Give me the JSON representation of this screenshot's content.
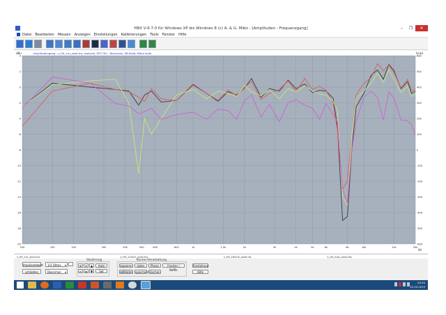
{
  "window": {
    "title": "HBX V-6.7.0 für Windows XP bis Windows 8   (c)  A. & G. Mätz - [Amplituden - Frequenzgang]",
    "controls": [
      "–",
      "❐",
      "✕"
    ]
  },
  "menu": {
    "items": [
      "Datei",
      "Bearbeiten",
      "Messen",
      "Anzeigen",
      "Einstellungen",
      "Kalibrierungen",
      "Tools",
      "Fenster",
      "Hilfe"
    ]
  },
  "toolbar": {
    "icons": [
      "folder-icon",
      "save-icon",
      "print-icon",
      "measure-icon",
      "sweep-icon",
      "impulse-icon",
      "waterfall-icon",
      "spectrum-icon",
      "phase-icon",
      "distortion-icon",
      "burst-icon",
      "filter-icon",
      "eq-icon",
      "tools-icon",
      "exit-icon"
    ],
    "colors": [
      "#2f6fd1",
      "#2a7fd0",
      "#7f8c9b",
      "#3a78c8",
      "#4a88d4",
      "#3c7cc2",
      "#3b70c0",
      "#b03a2e",
      "#1f2a44",
      "#4a64c8",
      "#c84040",
      "#305090",
      "#4b8ad6",
      "#2c8a3a",
      "#2f8a3a"
    ]
  },
  "chart_data": {
    "type": "line",
    "title": "Amplitudengang - s_HX_1m_axial.frq, analyzie, SPT-700 - Blackman, SB Kalib, Mikro kalib",
    "ylabel_left": "dBu",
    "ylabel_right": "Grad",
    "xlabel": "Hz",
    "x_scale": "log",
    "xlim": [
      100,
      20000
    ],
    "ylim": [
      -20,
      4
    ],
    "y2lim": [
      -600,
      600
    ],
    "left_ticks": [
      "4",
      "2",
      "0",
      "-2",
      "-4",
      "-6",
      "-8",
      "-10",
      "-12",
      "-14",
      "-16",
      "-18",
      "-20"
    ],
    "right_ticks": [
      "600",
      "500",
      "400",
      "300",
      "200",
      "100",
      "0",
      "-100",
      "-200",
      "-300",
      "-400",
      "-500",
      "-600"
    ],
    "x_ticks": [
      {
        "v": 100,
        "label": "100"
      },
      {
        "v": 150,
        "label": "150"
      },
      {
        "v": 200,
        "label": "200"
      },
      {
        "v": 300,
        "label": "300"
      },
      {
        "v": 400,
        "label": "400"
      },
      {
        "v": 500,
        "label": "500"
      },
      {
        "v": 600,
        "label": "600"
      },
      {
        "v": 800,
        "label": "800"
      },
      {
        "v": 1000,
        "label": "1k"
      },
      {
        "v": 1500,
        "label": "1,5k"
      },
      {
        "v": 2000,
        "label": "2k"
      },
      {
        "v": 3000,
        "label": "3k"
      },
      {
        "v": 4000,
        "label": "4k"
      },
      {
        "v": 5000,
        "label": "5k"
      },
      {
        "v": 6000,
        "label": "6k"
      },
      {
        "v": 8000,
        "label": "8k"
      },
      {
        "v": 10000,
        "label": "10k"
      },
      {
        "v": 15000,
        "label": "15k"
      },
      {
        "v": 20000,
        "label": "20k"
      }
    ],
    "grid": true,
    "series": [
      {
        "name": "s_HX_1m_axial.frq",
        "color": "#3a3a3a",
        "x": [
          100,
          150,
          250,
          350,
          420,
          480,
          520,
          570,
          650,
          800,
          1000,
          1200,
          1400,
          1600,
          1800,
          2000,
          2200,
          2500,
          2800,
          3200,
          3600,
          4000,
          4500,
          5000,
          5500,
          6000,
          6600,
          7000,
          7500,
          8000,
          8500,
          9000,
          10000,
          11000,
          12000,
          13000,
          14000,
          15000,
          16500,
          18000,
          19000,
          20000
        ],
        "y": [
          -2.5,
          0.5,
          0.0,
          -0.3,
          -0.5,
          -2.3,
          -1.0,
          -0.5,
          -1.9,
          -1.7,
          0.3,
          -0.8,
          -1.8,
          -0.6,
          -1.0,
          -0.1,
          1.1,
          -1.3,
          -0.2,
          -0.5,
          0.9,
          -0.2,
          0.4,
          -0.7,
          -0.4,
          -0.5,
          -1.4,
          -5.0,
          -17.0,
          -16.5,
          -8.0,
          -2.5,
          -0.8,
          1.5,
          2.2,
          1.0,
          2.9,
          2.1,
          -0.2,
          0.7,
          -0.8,
          -0.5
        ]
      },
      {
        "name": "s_HX_120cm_axial.frq",
        "color": "#e05a5a",
        "x": [
          100,
          150,
          250,
          350,
          420,
          480,
          520,
          570,
          650,
          800,
          1000,
          1200,
          1400,
          1600,
          1800,
          2000,
          2200,
          2500,
          2800,
          3200,
          3600,
          4000,
          4500,
          5000,
          5500,
          6000,
          6600,
          7000,
          7500,
          8000,
          8500,
          9000,
          10000,
          11000,
          12000,
          13000,
          14000,
          15000,
          16500,
          18000,
          19000,
          20000
        ],
        "y": [
          -5.0,
          -0.5,
          0.5,
          -0.3,
          -0.6,
          -1.3,
          -1.8,
          -0.2,
          -1.5,
          -1.7,
          0.4,
          -0.8,
          -1.7,
          -0.4,
          -1.1,
          0.0,
          0.7,
          -1.6,
          -0.8,
          -0.3,
          0.8,
          -0.6,
          1.1,
          -0.3,
          0.1,
          -0.4,
          -2.0,
          -5.5,
          -13.0,
          -12.0,
          -6.0,
          -1.0,
          0.5,
          1.2,
          3.0,
          2.1,
          2.8,
          1.9,
          -0.1,
          1.0,
          -0.5,
          -0.2
        ]
      },
      {
        "name": "s_HX_160cm_axial.frq",
        "color": "#c8e67a",
        "x": [
          100,
          150,
          250,
          350,
          420,
          480,
          520,
          570,
          650,
          800,
          1000,
          1200,
          1400,
          1600,
          1800,
          2000,
          2200,
          2500,
          2800,
          3200,
          3600,
          4000,
          4500,
          5000,
          5500,
          6000,
          6600,
          7000,
          7500,
          8000,
          8500,
          9000,
          10000,
          11000,
          12000,
          13000,
          14000,
          15000,
          16500,
          18000,
          19000,
          20000
        ],
        "y": [
          -2.5,
          0.3,
          0.8,
          1.0,
          -2.0,
          -11.0,
          -4.0,
          -6.0,
          -4.0,
          -1.0,
          -0.3,
          -1.5,
          -0.5,
          -0.8,
          -1.2,
          0.2,
          -0.6,
          -1.1,
          -0.3,
          -1.5,
          -0.2,
          -0.6,
          0.2,
          -0.5,
          -0.9,
          -1.0,
          -1.8,
          -3.0,
          -14.0,
          -15.0,
          -6.0,
          -1.5,
          -0.5,
          0.5,
          1.8,
          0.6,
          2.2,
          1.0,
          -0.7,
          0.1,
          -1.2,
          -0.9
        ]
      },
      {
        "name": "s_HX_mau_axial.frq",
        "color": "#d060d0",
        "x": [
          100,
          150,
          250,
          350,
          420,
          480,
          520,
          570,
          650,
          800,
          1000,
          1200,
          1400,
          1600,
          1800,
          2000,
          2200,
          2500,
          2800,
          3200,
          3600,
          4000,
          4500,
          5000,
          5500,
          6000,
          6600,
          7000,
          7500,
          8000,
          8500,
          9000,
          10000,
          11000,
          12000,
          13000,
          14000,
          15000,
          16500,
          18000,
          19000,
          20000
        ],
        "y": [
          -2.7,
          1.3,
          0.5,
          -2.1,
          -2.4,
          -3.4,
          -3.1,
          -2.7,
          -4.1,
          -3.5,
          -3.2,
          -4.1,
          -2.8,
          -3.0,
          -4.1,
          -1.7,
          -1.0,
          -3.8,
          -2.2,
          -4.4,
          -2.0,
          -1.6,
          -2.3,
          -2.7,
          -4.1,
          -2.1,
          -3.5,
          -4.4,
          -13.0,
          -14.8,
          -8.0,
          -4.4,
          -1.3,
          -0.5,
          -1.3,
          -4.2,
          -0.6,
          -1.4,
          -4.2,
          -4.3,
          -4.8,
          -6.1
        ]
      }
    ]
  },
  "legend_bar": {
    "items": [
      "s_HX_1m_axial.frq",
      "s_HX_120cm_axial.frq",
      "s_HX_160cm_axial.frq",
      "s_HX_mau_axial.frq"
    ]
  },
  "controls": {
    "skalierung_label": "Skalierung",
    "kurven_label": "Kurven-Verarbeitung",
    "impulsantwort": "Impulsantwort",
    "schliessen": "schließen",
    "octave_select": "1/3 Oktav",
    "window_select": "Blackman",
    "auto": "Auto",
    "set": "Set",
    "kopieren": "kopieren",
    "laden": "laden",
    "phase": "Phase",
    "fenster_baffle": "Fenster / Baffle",
    "einstellung": "Einstellung",
    "editieren": "editieren",
    "speichern": "speichern",
    "loeschen": "löschen",
    "hilfe": "Hilfe"
  },
  "taskbar": {
    "time": "20:50",
    "date": "22.04.2015",
    "apps": [
      "windows-start-icon",
      "explorer-icon",
      "firefox-icon",
      "word-icon",
      "excel-icon",
      "media-icon",
      "powerpoint-icon",
      "calculator-icon",
      "settings-icon",
      "media-player-icon",
      "hbx-icon"
    ]
  }
}
